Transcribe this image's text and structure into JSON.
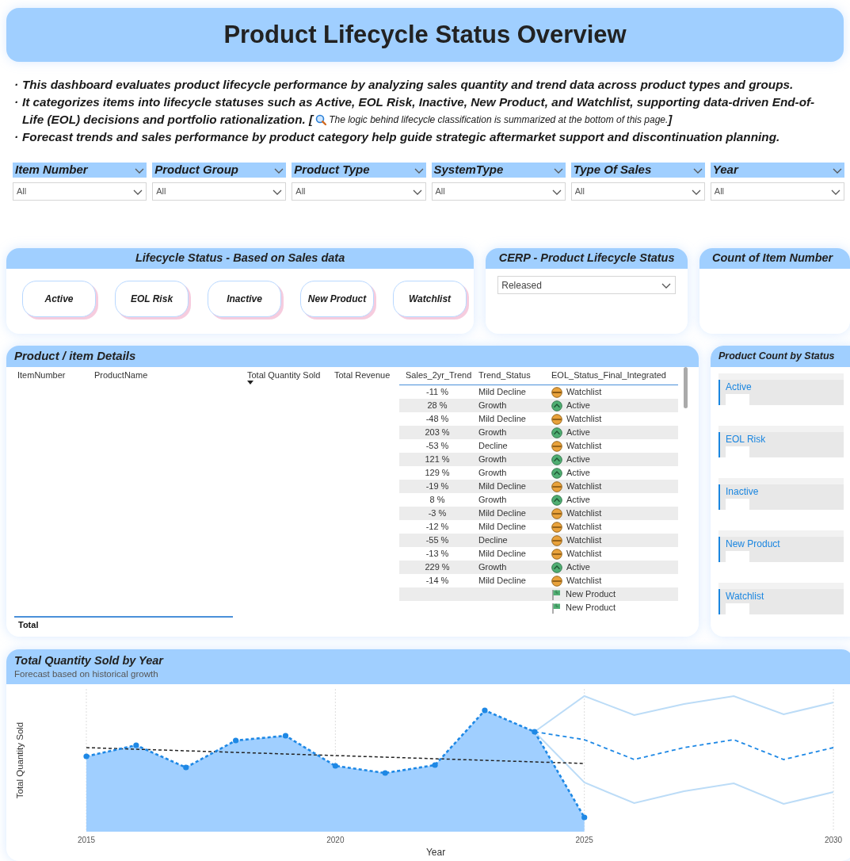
{
  "header": {
    "title": "Product Lifecycle Status Overview"
  },
  "description": [
    {
      "marker": "·",
      "text": "This dashboard evaluates product lifecycle performance by analyzing sales quantity and trend data across product types and groups."
    },
    {
      "marker": "·",
      "lines": [
        "It categorizes items into lifecycle statuses such as Active, EOL Risk, Inactive, New Product, and Watchlist, supporting data-driven End-of-",
        "Life (EOL) decisions and portfolio rationalization. ["
      ],
      "note": "The logic behind lifecycle classification is summarized at the bottom of this page.",
      "close": "]"
    },
    {
      "marker": "·",
      "text": "Forecast trends and sales performance by product category help guide strategic aftermarket support and discontinuation planning."
    }
  ],
  "filters": [
    {
      "label": "Item Number",
      "value": "All"
    },
    {
      "label": "Product Group",
      "value": "All"
    },
    {
      "label": "Product Type",
      "value": "All"
    },
    {
      "label": "SystemType",
      "value": "All"
    },
    {
      "label": "Type Of Sales",
      "value": "All"
    },
    {
      "label": "Year",
      "value": "All"
    }
  ],
  "lifecycle_status": {
    "title": "Lifecycle Status - Based on Sales data",
    "buttons": [
      "Active",
      "EOL Risk",
      "Inactive",
      "New Product",
      "Watchlist"
    ]
  },
  "cerp_status": {
    "title": "CERP - Product Lifecycle Status",
    "value": "Released"
  },
  "count_card": {
    "title": "Count of Item Number"
  },
  "details": {
    "title": "Product / item Details",
    "columns": [
      {
        "label": "ItemNumber",
        "sorted": false
      },
      {
        "label": "ProductName",
        "sorted": false
      },
      {
        "label": "Total Quantity Sold",
        "sorted": true
      },
      {
        "label": "Total Revenue",
        "sorted": false
      },
      {
        "label": "Sales_2yr_Trend",
        "sorted": false
      },
      {
        "label": "Trend_Status",
        "sorted": false
      },
      {
        "label": "EOL_Status_Final_Integrated",
        "sorted": false
      }
    ],
    "rows": [
      {
        "trend": "-11 %",
        "status": "Mild Decline",
        "kind": "watchlist",
        "eol": "Watchlist"
      },
      {
        "trend": "28 %",
        "status": "Growth",
        "kind": "active",
        "eol": "Active"
      },
      {
        "trend": "-48 %",
        "status": "Mild Decline",
        "kind": "watchlist",
        "eol": "Watchlist"
      },
      {
        "trend": "203 %",
        "status": "Growth",
        "kind": "active",
        "eol": "Active"
      },
      {
        "trend": "-53 %",
        "status": "Decline",
        "kind": "watchlist",
        "eol": "Watchlist"
      },
      {
        "trend": "121 %",
        "status": "Growth",
        "kind": "active",
        "eol": "Active"
      },
      {
        "trend": "129 %",
        "status": "Growth",
        "kind": "active",
        "eol": "Active"
      },
      {
        "trend": "-19 %",
        "status": "Mild Decline",
        "kind": "watchlist",
        "eol": "Watchlist"
      },
      {
        "trend": "8 %",
        "status": "Growth",
        "kind": "active",
        "eol": "Active"
      },
      {
        "trend": "-3 %",
        "status": "Mild Decline",
        "kind": "watchlist",
        "eol": "Watchlist"
      },
      {
        "trend": "-12 %",
        "status": "Mild Decline",
        "kind": "watchlist",
        "eol": "Watchlist"
      },
      {
        "trend": "-55 %",
        "status": "Decline",
        "kind": "watchlist",
        "eol": "Watchlist"
      },
      {
        "trend": "-13 %",
        "status": "Mild Decline",
        "kind": "watchlist",
        "eol": "Watchlist"
      },
      {
        "trend": "229 %",
        "status": "Growth",
        "kind": "active",
        "eol": "Active"
      },
      {
        "trend": "-14 %",
        "status": "Mild Decline",
        "kind": "watchlist",
        "eol": "Watchlist"
      },
      {
        "kind": "new",
        "eol": "New Product"
      },
      {
        "kind": "new",
        "eol": "New Product"
      }
    ],
    "total_label": "Total"
  },
  "product_count": {
    "title": "Product Count by Status",
    "items": [
      "Active",
      "EOL Risk",
      "Inactive",
      "New Product",
      "Watchlist"
    ]
  },
  "chart": {
    "title": "Total Quantity Sold by Year",
    "subtitle": "Forecast based on historical growth",
    "xlabel": "Year",
    "ylabel": "Total Quantity Sold",
    "xticks": [
      "2015",
      "2020",
      "2025",
      "2030"
    ]
  }
}
